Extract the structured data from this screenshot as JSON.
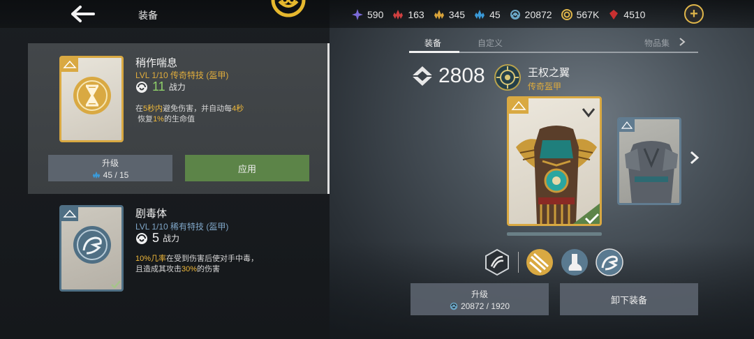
{
  "header": {
    "title": "装备",
    "resources": [
      {
        "icon": "purple-star-icon",
        "value": "590",
        "color": "#7a6ad8"
      },
      {
        "icon": "red-crystal-icon",
        "value": "163",
        "color": "#d04040"
      },
      {
        "icon": "gold-crystal-icon",
        "value": "345",
        "color": "#d9a33a"
      },
      {
        "icon": "blue-crystal-icon",
        "value": "45",
        "color": "#3a9ad9"
      },
      {
        "icon": "swirl-power-icon",
        "value": "20872",
        "color": "#6aa6c6"
      },
      {
        "icon": "gold-coin-icon",
        "value": "567K",
        "color": "#e0b64a"
      },
      {
        "icon": "red-ruby-icon",
        "value": "4510",
        "color": "#c83030"
      }
    ],
    "plus_label": "+"
  },
  "left": {
    "skills": [
      {
        "name": "稍作喘息",
        "level": "LVL  1/10  传奇特技 (盔甲)",
        "level_color": "#e0ac3c",
        "power": "11",
        "power_color": "#8fd06a",
        "power_label": "战力",
        "desc_parts": [
          "在",
          "5秒内",
          "避免伤害，并自动每",
          "4秒"
        ],
        "desc_line2_parts": [
          "恢复",
          "1%",
          "的生命值"
        ],
        "icon": "hourglass-icon"
      },
      {
        "name": "剧毒体",
        "level": "LVL  1/10  稀有特技 (盔甲)",
        "level_color": "#7fa6c8",
        "power": "5",
        "power_color": "#f2f2f2",
        "power_label": "战力",
        "desc_parts": [
          "10%几率",
          "在受到伤害后使对手中毒，"
        ],
        "desc_line2_parts": [
          "且造成其攻击",
          "30%",
          "的伤害"
        ],
        "icon": "snake-icon"
      }
    ],
    "upgrade": {
      "label": "升级",
      "cost": "45 / 15"
    },
    "apply_label": "应用"
  },
  "right": {
    "tabs": [
      {
        "label": "装备",
        "active": true
      },
      {
        "label": "自定义",
        "active": false
      },
      {
        "label": "物品集",
        "active": false
      }
    ],
    "score": "2808",
    "gear_name": "王权之翼",
    "gear_rarity": "传奇盔甲",
    "gear_rarity_color": "#e0ac3c",
    "upgrade": {
      "label": "升级",
      "cost": "20872 / 1920"
    },
    "unequip_label": "卸下装备",
    "abilities": [
      "claw-slash-icon",
      "triple-slash-icon",
      "foot-icon",
      "snake-icon"
    ]
  }
}
